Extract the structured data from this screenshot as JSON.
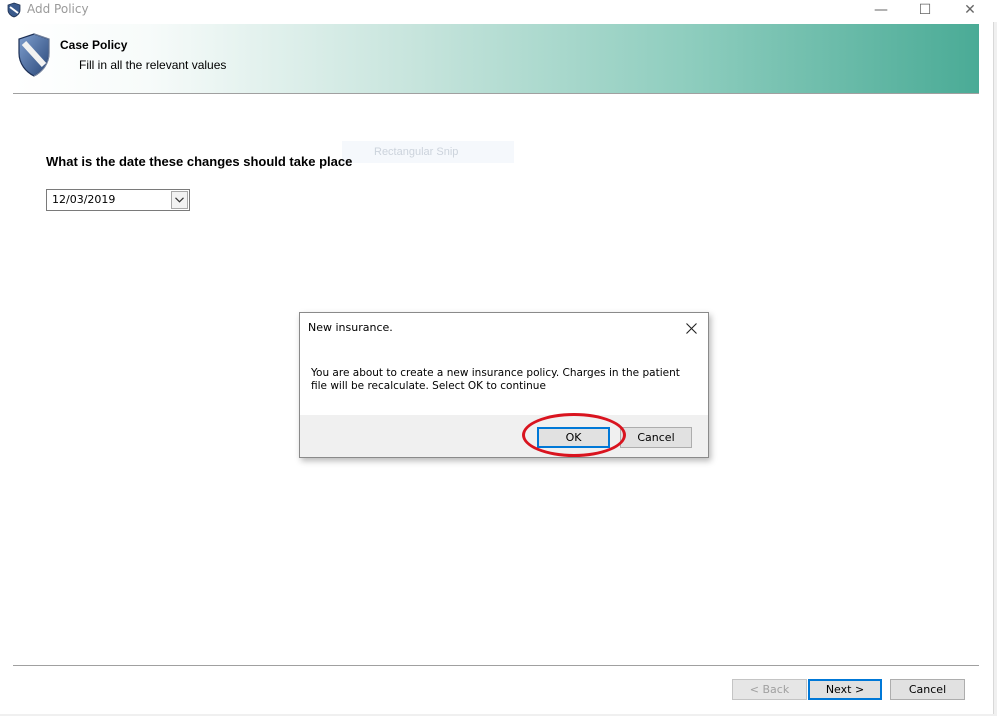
{
  "window": {
    "title": "Add Policy",
    "minimize_glyph": "—",
    "maximize_glyph": "☐",
    "close_glyph": "✕"
  },
  "header": {
    "title": "Case Policy",
    "subtitle": "Fill in all the relevant values",
    "gradient_colors": [
      "#ffffff",
      "#c6e4dc",
      "#4aab96"
    ]
  },
  "ghost_overlay": {
    "text": "Rectangular Snip"
  },
  "form": {
    "question": "What is the date these changes should take place",
    "date_value": "12/03/2019"
  },
  "dialog": {
    "title": "New insurance.",
    "message": "You are about to create a new insurance policy.  Charges in the patient file will be recalculate.  Select OK to continue",
    "ok_label": "OK",
    "cancel_label": "Cancel",
    "highlight_color": "#d9141f"
  },
  "wizard_buttons": {
    "back_label": "< Back",
    "next_label": "Next >",
    "cancel_label": "Cancel"
  },
  "colors": {
    "accent": "#0078d7",
    "window_title": "#9a9a9a"
  },
  "icons": {
    "app": "shield-icon",
    "header": "shield-icon",
    "dropdown": "chevron-down-icon",
    "dialog_close": "close-icon"
  }
}
